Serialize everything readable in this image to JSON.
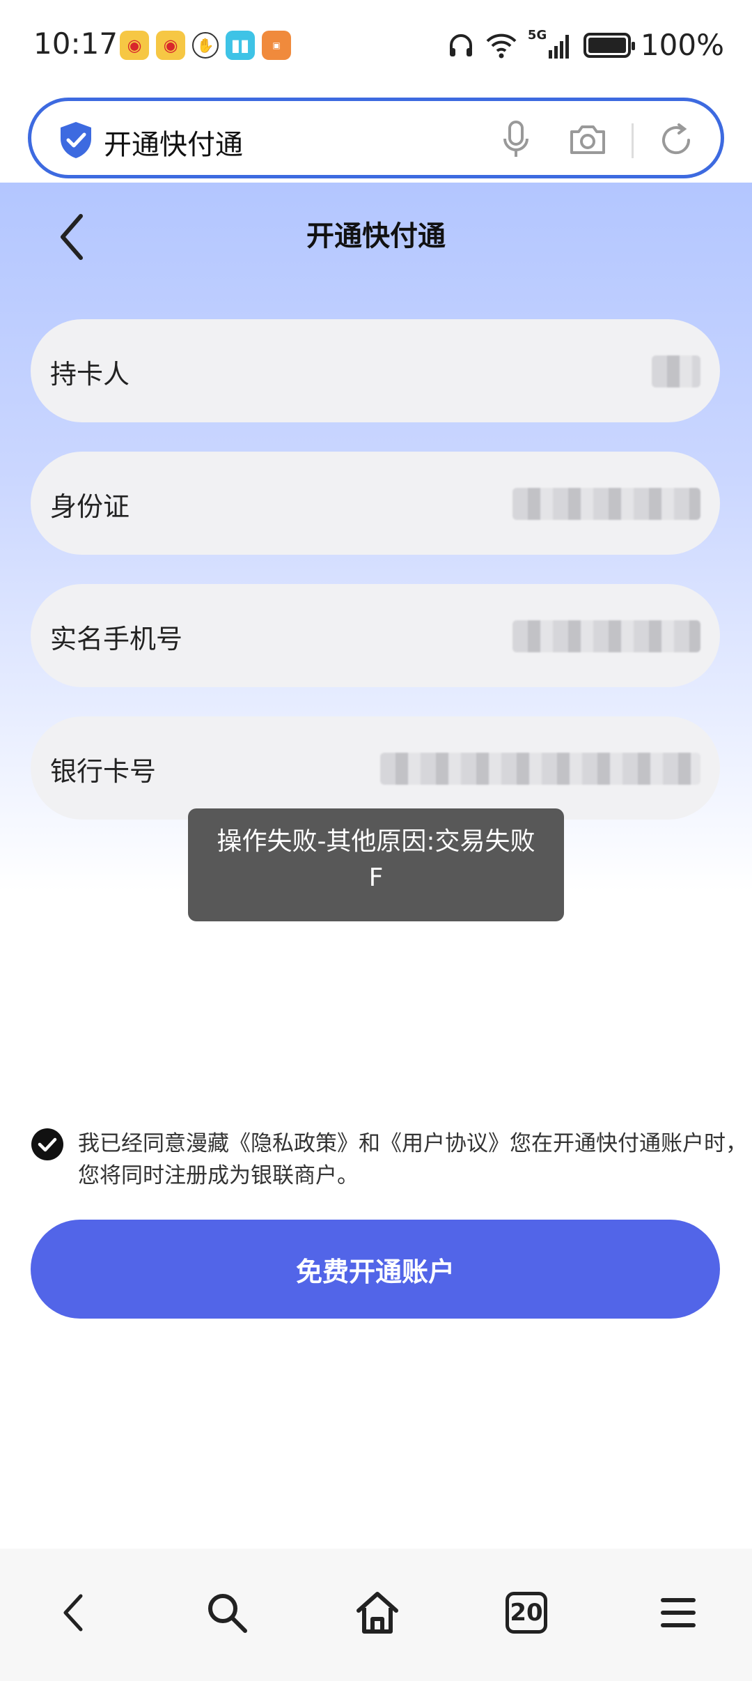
{
  "status_bar": {
    "time": "10:17",
    "battery_percent": "100%",
    "network": "5G"
  },
  "search": {
    "query": "开通快付通"
  },
  "page": {
    "title": "开通快付通",
    "fields": [
      {
        "label": "持卡人"
      },
      {
        "label": "身份证"
      },
      {
        "label": "实名手机号"
      },
      {
        "label": "银行卡号"
      }
    ]
  },
  "toast": {
    "message": "操作失败-其他原因:交易失败F"
  },
  "agreement": {
    "text": "我已经同意漫藏《隐私政策》和《用户协议》您在开通快付通账户时，您将同时注册成为银联商户。",
    "checked": true
  },
  "primary_button": {
    "label": "免费开通账户"
  },
  "bottom_nav": {
    "tab_count": "20"
  },
  "colors": {
    "accent": "#5265e8",
    "search_border": "#3d6ae0",
    "toast_bg": "#585858"
  }
}
